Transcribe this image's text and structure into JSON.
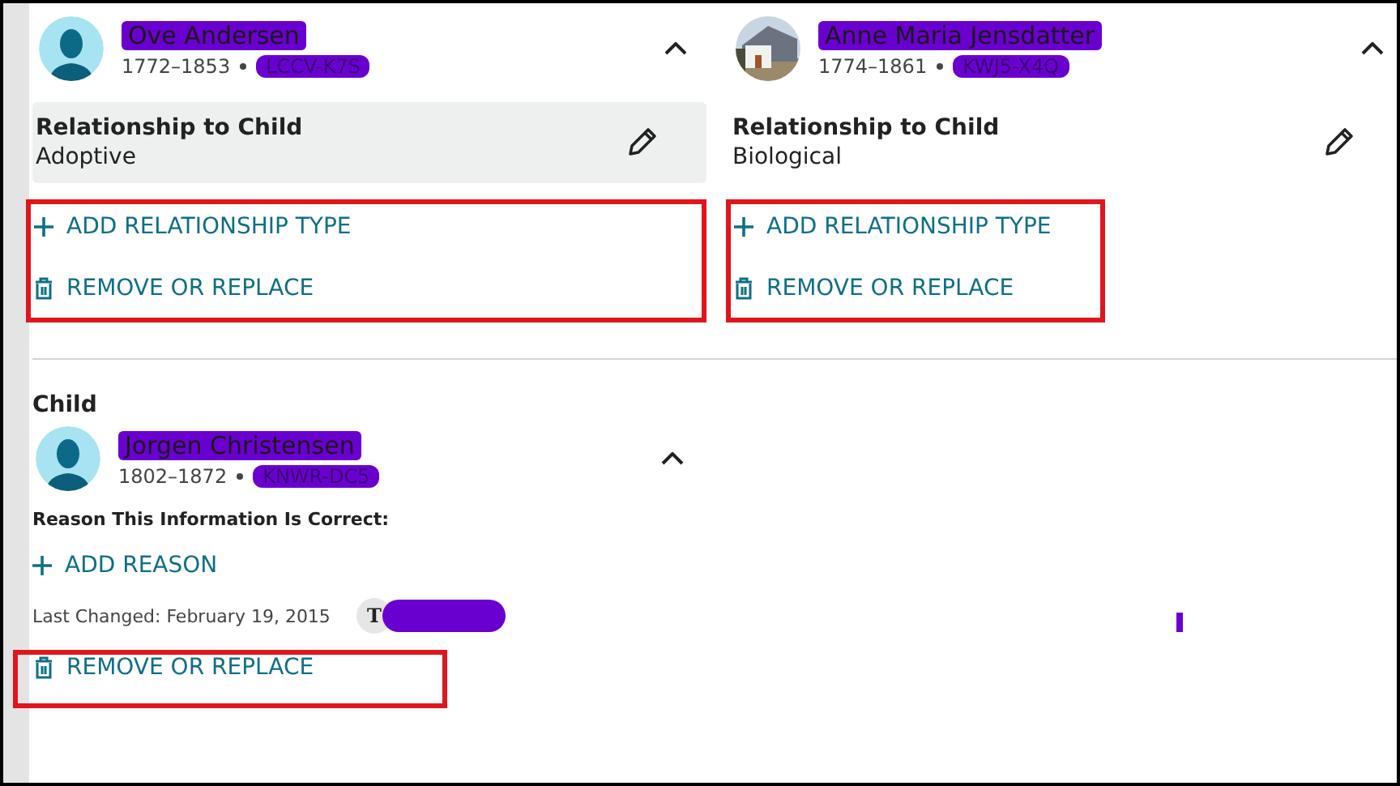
{
  "parents": [
    {
      "name": "Ove Andersen",
      "lifespan": "1772–1853",
      "pid": "LCCV-K7S",
      "avatar": {
        "kind": "silhouette"
      },
      "expanded": true,
      "relationship_label": "Relationship to Child",
      "relationship_value": "Adoptive",
      "highlighted": true,
      "add_label": "ADD RELATIONSHIP TYPE",
      "remove_label": "REMOVE OR REPLACE"
    },
    {
      "name": "Anne Maria Jensdatter",
      "lifespan": "1774–1861",
      "pid": "KWJ5-X4Q",
      "expanded": true,
      "relationship_label": "Relationship to Child",
      "relationship_value": "Biological",
      "highlighted": false,
      "add_label": "ADD RELATIONSHIP TYPE",
      "remove_label": "REMOVE OR REPLACE"
    }
  ],
  "child": {
    "heading": "Child",
    "name": "Jorgen Christensen",
    "lifespan": "1802–1872",
    "pid": "KNWR-DC5",
    "avatar": {
      "kind": "silhouette"
    },
    "expanded": true,
    "reason_label": "Reason This Information Is Correct:",
    "add_reason": "ADD REASON",
    "last_changed": "Last Changed: February 19, 2015",
    "contributor_initial": "T",
    "remove_label": "REMOVE OR REPLACE"
  }
}
